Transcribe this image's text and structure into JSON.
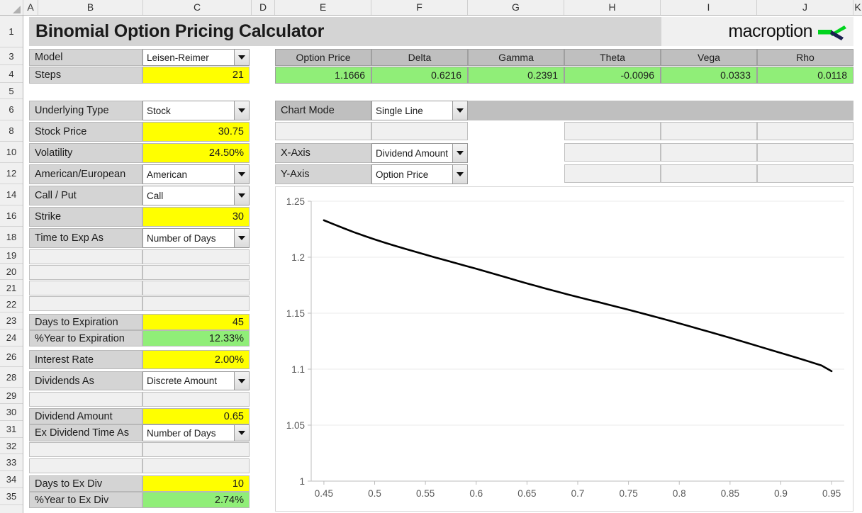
{
  "window": {
    "title": "Binomial Option Pricing Calculator",
    "brand": "macroption"
  },
  "columns": [
    "A",
    "B",
    "C",
    "D",
    "E",
    "F",
    "G",
    "H",
    "I",
    "J",
    "K"
  ],
  "rows": [
    1,
    3,
    4,
    5,
    6,
    8,
    10,
    12,
    14,
    16,
    18,
    19,
    20,
    21,
    22,
    23,
    24,
    26,
    28,
    29,
    30,
    31,
    32,
    33,
    34,
    35
  ],
  "inputs": {
    "model": {
      "label": "Model",
      "value": "Leisen-Reimer",
      "type": "dropdown"
    },
    "steps": {
      "label": "Steps",
      "value": "21",
      "type": "yellow"
    },
    "underlying_type": {
      "label": "Underlying Type",
      "value": "Stock",
      "type": "dropdown"
    },
    "stock_price": {
      "label": "Stock Price",
      "value": "30.75",
      "type": "yellow"
    },
    "volatility": {
      "label": "Volatility",
      "value": "24.50%",
      "type": "yellow"
    },
    "american_european": {
      "label": "American/European",
      "value": "American",
      "type": "dropdown"
    },
    "call_put": {
      "label": "Call / Put",
      "value": "Call",
      "type": "dropdown"
    },
    "strike": {
      "label": "Strike",
      "value": "30",
      "type": "yellow"
    },
    "time_to_exp_as": {
      "label": "Time to Exp As",
      "value": "Number of Days",
      "type": "dropdown"
    },
    "days_to_expiration": {
      "label": "Days to Expiration",
      "value": "45",
      "type": "yellow"
    },
    "pct_year_to_expiration": {
      "label": "%Year to Expiration",
      "value": "12.33%",
      "type": "green"
    },
    "interest_rate": {
      "label": "Interest Rate",
      "value": "2.00%",
      "type": "yellow"
    },
    "dividends_as": {
      "label": "Dividends As",
      "value": "Discrete Amount",
      "type": "dropdown"
    },
    "dividend_amount": {
      "label": "Dividend Amount",
      "value": "0.65",
      "type": "yellow"
    },
    "ex_dividend_time_as": {
      "label": "Ex Dividend Time As",
      "value": "Number of Days",
      "type": "dropdown"
    },
    "days_to_ex_div": {
      "label": "Days to Ex Div",
      "value": "10",
      "type": "yellow"
    },
    "pct_year_to_ex_div": {
      "label": "%Year to Ex Div",
      "value": "2.74%",
      "type": "green"
    }
  },
  "results": {
    "headers": [
      "Option Price",
      "Delta",
      "Gamma",
      "Theta",
      "Vega",
      "Rho"
    ],
    "values": [
      "1.1666",
      "0.6216",
      "0.2391",
      "-0.0096",
      "0.0333",
      "0.0118"
    ]
  },
  "chart_controls": {
    "chart_mode": {
      "label": "Chart Mode",
      "value": "Single Line"
    },
    "x_axis": {
      "label": "X-Axis",
      "value": "Dividend Amount"
    },
    "y_axis": {
      "label": "Y-Axis",
      "value": "Option Price"
    }
  },
  "colors": {
    "input_yellow": "#ffff00",
    "calc_green": "#90ee78",
    "label_grey": "#d4d4d4",
    "header_grey": "#bfbfbf",
    "line": "#000000",
    "brand_green": "#00d41e",
    "brand_navy": "#1b2050"
  },
  "chart_data": {
    "type": "line",
    "title": "",
    "xlabel": "",
    "ylabel": "",
    "xlim": [
      0.4375,
      0.9625
    ],
    "ylim": [
      1,
      1.25
    ],
    "grid": true,
    "legend": false,
    "xticks": [
      "0.45",
      "0.5",
      "0.55",
      "0.6",
      "0.65",
      "0.7",
      "0.75",
      "0.8",
      "0.85",
      "0.9",
      "0.95"
    ],
    "yticks": [
      "1",
      "1.05",
      "1.1",
      "1.15",
      "1.2",
      "1.25"
    ],
    "series": [
      {
        "name": "Option Price",
        "x": [
          0.45,
          0.46,
          0.47,
          0.48,
          0.49,
          0.5,
          0.51,
          0.52,
          0.53,
          0.54,
          0.55,
          0.56,
          0.57,
          0.58,
          0.59,
          0.6,
          0.61,
          0.62,
          0.63,
          0.64,
          0.65,
          0.66,
          0.67,
          0.68,
          0.69,
          0.7,
          0.71,
          0.72,
          0.73,
          0.74,
          0.75,
          0.76,
          0.77,
          0.78,
          0.79,
          0.8,
          0.81,
          0.82,
          0.83,
          0.84,
          0.85,
          0.86,
          0.87,
          0.88,
          0.89,
          0.9,
          0.91,
          0.92,
          0.93,
          0.94,
          0.95
        ],
        "y": [
          1.233,
          1.2293,
          1.2257,
          1.2222,
          1.219,
          1.2159,
          1.213,
          1.2102,
          1.2075,
          1.2049,
          1.2023,
          1.1997,
          1.1972,
          1.1947,
          1.1922,
          1.1897,
          1.1871,
          1.1845,
          1.1819,
          1.1792,
          1.1766,
          1.1741,
          1.1716,
          1.1692,
          1.1668,
          1.1645,
          1.1622,
          1.16,
          1.1577,
          1.1554,
          1.1531,
          1.1507,
          1.1483,
          1.1459,
          1.1434,
          1.1409,
          1.1384,
          1.1358,
          1.1332,
          1.1306,
          1.128,
          1.1253,
          1.1226,
          1.1199,
          1.1172,
          1.1145,
          1.1118,
          1.109,
          1.1062,
          1.1033,
          1.0982
        ]
      }
    ]
  }
}
